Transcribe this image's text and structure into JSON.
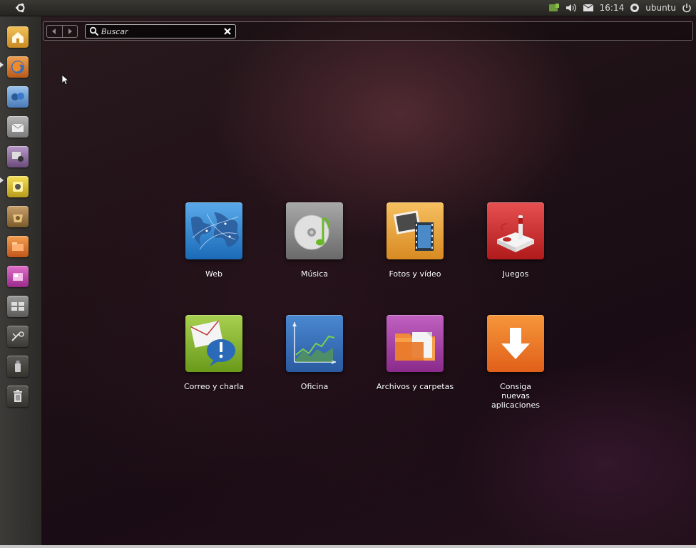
{
  "top_panel": {
    "time": "16:14",
    "user": "ubuntu",
    "icons": [
      "ubuntu-logo-icon",
      "network-icon",
      "volume-icon",
      "mail-icon",
      "user-icon",
      "power-icon"
    ]
  },
  "launcher": {
    "items": [
      {
        "name": "home-folder-icon",
        "color": "#e3a63a"
      },
      {
        "name": "firefox-icon",
        "color": "#d9803a"
      },
      {
        "name": "empathy-icon",
        "color": "#6ea0d8"
      },
      {
        "name": "evolution-icon",
        "color": "#9a9a9a"
      },
      {
        "name": "shotwell-icon",
        "color": "#8a6a9a"
      },
      {
        "name": "banshee-icon",
        "color": "#d6c23a"
      },
      {
        "name": "software-center-icon",
        "color": "#9a7a4a"
      },
      {
        "name": "applications-lens-icon",
        "color": "#e0782a"
      },
      {
        "name": "files-lens-icon",
        "color": "#c04aa0"
      },
      {
        "name": "workspaces-icon",
        "color": "#7a7a78"
      },
      {
        "name": "settings-icon",
        "color": "#55544f"
      },
      {
        "name": "usb-drive-icon",
        "color": "#4a4944"
      },
      {
        "name": "trash-icon",
        "color": "#4a4944"
      }
    ]
  },
  "dash": {
    "search": {
      "placeholder": "Buscar",
      "value": ""
    },
    "shortcuts": [
      {
        "label": "Web",
        "icon": "web-globe-icon"
      },
      {
        "label": "Música",
        "icon": "music-disc-icon"
      },
      {
        "label": "Fotos y vídeo",
        "icon": "photos-video-icon"
      },
      {
        "label": "Juegos",
        "icon": "joystick-icon"
      },
      {
        "label": "Correo y charla",
        "icon": "mail-chat-icon"
      },
      {
        "label": "Oficina",
        "icon": "office-chart-icon"
      },
      {
        "label": "Archivos y carpetas",
        "icon": "folder-files-icon"
      },
      {
        "label": "Consiga nuevas aplicaciones",
        "icon": "download-arrow-icon"
      }
    ]
  },
  "colors": {
    "web": "#3a8fd6",
    "music": "#8e8e8e",
    "photos": "#e8a53a",
    "games": "#d23434",
    "mail": "#8dbb3a",
    "office": "#3a6fb8",
    "files": "#a03ea0",
    "get_apps": "#ee7a2a"
  }
}
